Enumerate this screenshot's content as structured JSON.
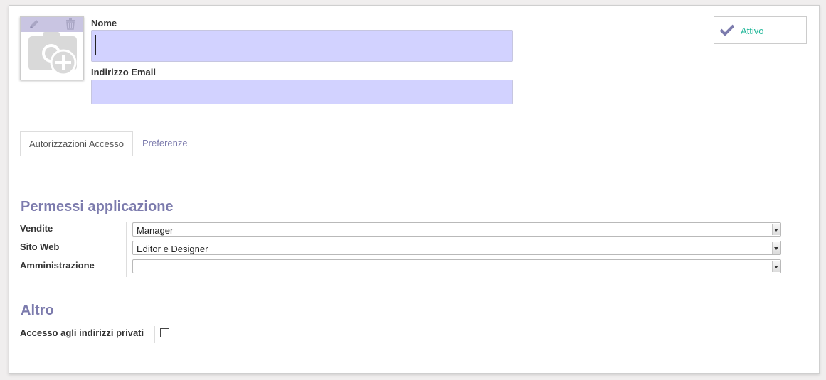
{
  "form": {
    "name_label": "Nome",
    "name_value": "",
    "email_label": "Indirizzo Email",
    "email_value": "",
    "active_label": "Attivo"
  },
  "tabs": [
    {
      "label": "Autorizzazioni Accesso",
      "active": true
    },
    {
      "label": "Preferenze",
      "active": false
    }
  ],
  "permissions": {
    "title": "Permessi applicazione",
    "rows": [
      {
        "label": "Vendite",
        "value": "Manager"
      },
      {
        "label": "Sito Web",
        "value": "Editor e Designer"
      },
      {
        "label": "Amministrazione",
        "value": ""
      }
    ]
  },
  "other": {
    "title": "Altro",
    "private_address_label": "Accesso agli indirizzi privati",
    "private_address_checked": false
  },
  "colors": {
    "accent": "#7c7bad",
    "input_bg": "#d2d2ff",
    "active_text": "#21b799"
  },
  "icons": [
    "pencil-icon",
    "trash-icon",
    "camera-add-icon",
    "checkmark-icon",
    "chevron-down-icon"
  ]
}
